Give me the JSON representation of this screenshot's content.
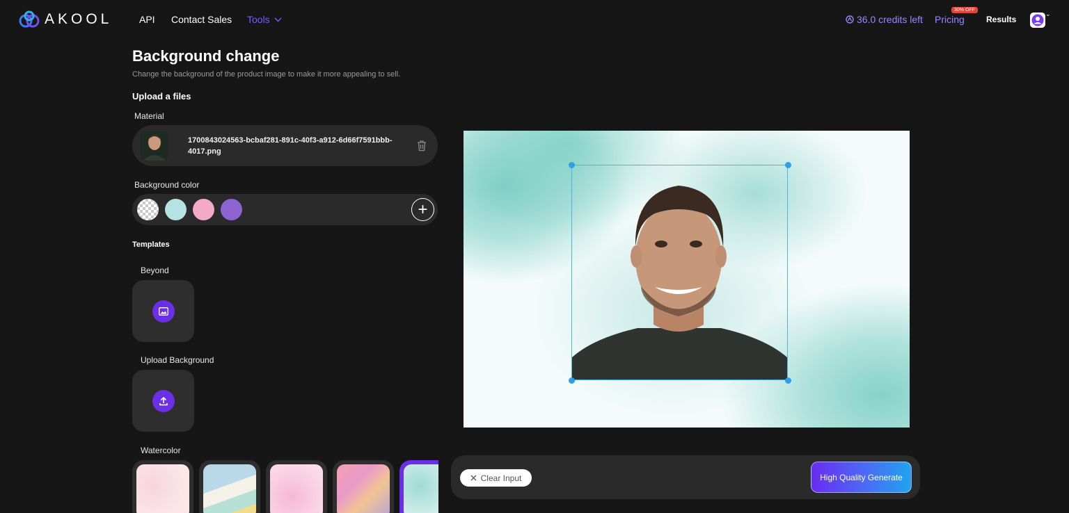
{
  "nav": {
    "logo_text": "AKOOL",
    "links": [
      {
        "label": "API"
      },
      {
        "label": "Contact Sales"
      },
      {
        "label": "Tools"
      }
    ],
    "credits": "36.0 credits left",
    "pricing": "Pricing",
    "pricing_badge": "30% OFF",
    "results": "Results"
  },
  "page": {
    "title": "Background change",
    "subtitle": "Change the background of the product image to make it more appealing to sell.",
    "upload_heading": "Upload a files"
  },
  "material": {
    "label": "Material",
    "filename": "1700843024563-bcbaf281-891c-40f3-a912-6d66f7591bbb-4017.png"
  },
  "background_color": {
    "label": "Background color",
    "swatches": [
      {
        "name": "transparent"
      },
      {
        "name": "mint",
        "color": "#b5e2e2"
      },
      {
        "name": "pink",
        "color": "#f4a9c6"
      },
      {
        "name": "purple",
        "color": "#8d63d0"
      }
    ]
  },
  "templates": {
    "heading": "Templates",
    "beyond_label": "Beyond",
    "upload_bg_label": "Upload Background",
    "watercolor_label": "Watercolor"
  },
  "actions": {
    "clear_input": "Clear Input",
    "generate": "High Quality Generate"
  },
  "colors": {
    "accent": "#6b2fe8",
    "link_purple": "#9a86ff",
    "selection_blue": "#4fb3ea"
  }
}
